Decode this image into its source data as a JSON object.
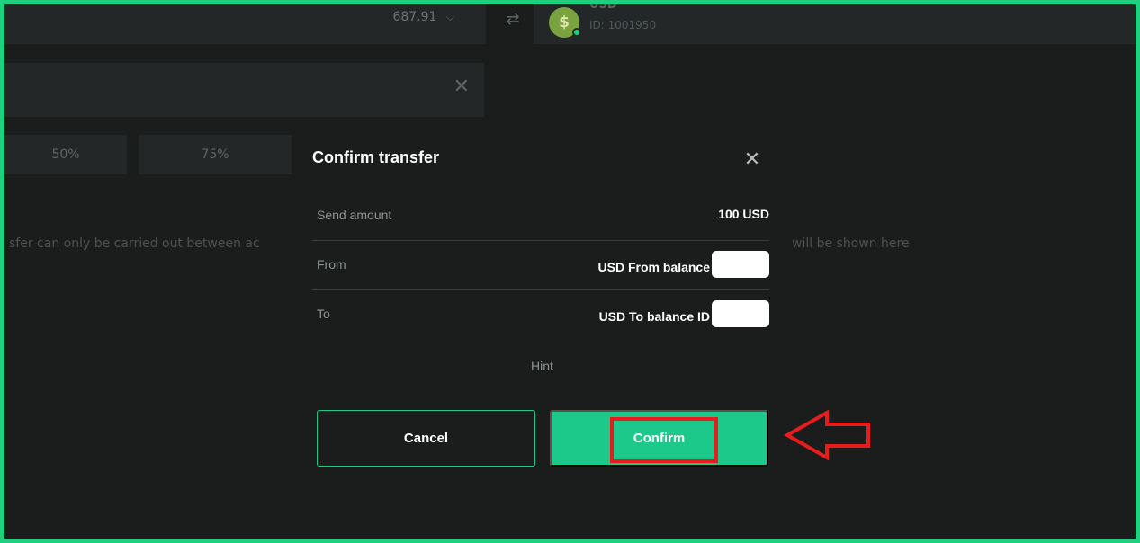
{
  "background": {
    "balance_value": "687.91",
    "account": {
      "coin_symbol": "$",
      "currency_code": "USD",
      "id_text": "ID: 1001950"
    },
    "percent_options": [
      "50%",
      "75%"
    ],
    "notice_text": "sfer can only be carried out between ac",
    "shown_text": "will be shown here"
  },
  "modal": {
    "title": "Confirm transfer",
    "rows": [
      {
        "label": "Send amount",
        "value": "100 USD"
      },
      {
        "label": "From",
        "value": "USD From balance"
      },
      {
        "label": "To",
        "value": "USD To balance ID"
      }
    ],
    "hint": "Hint",
    "cancel_label": "Cancel",
    "confirm_label": "Confirm"
  },
  "colors": {
    "accent": "#1dc98a",
    "frame_border": "#1fd17f",
    "annotation": "#e81c1c",
    "background": "#1b1d1d"
  }
}
